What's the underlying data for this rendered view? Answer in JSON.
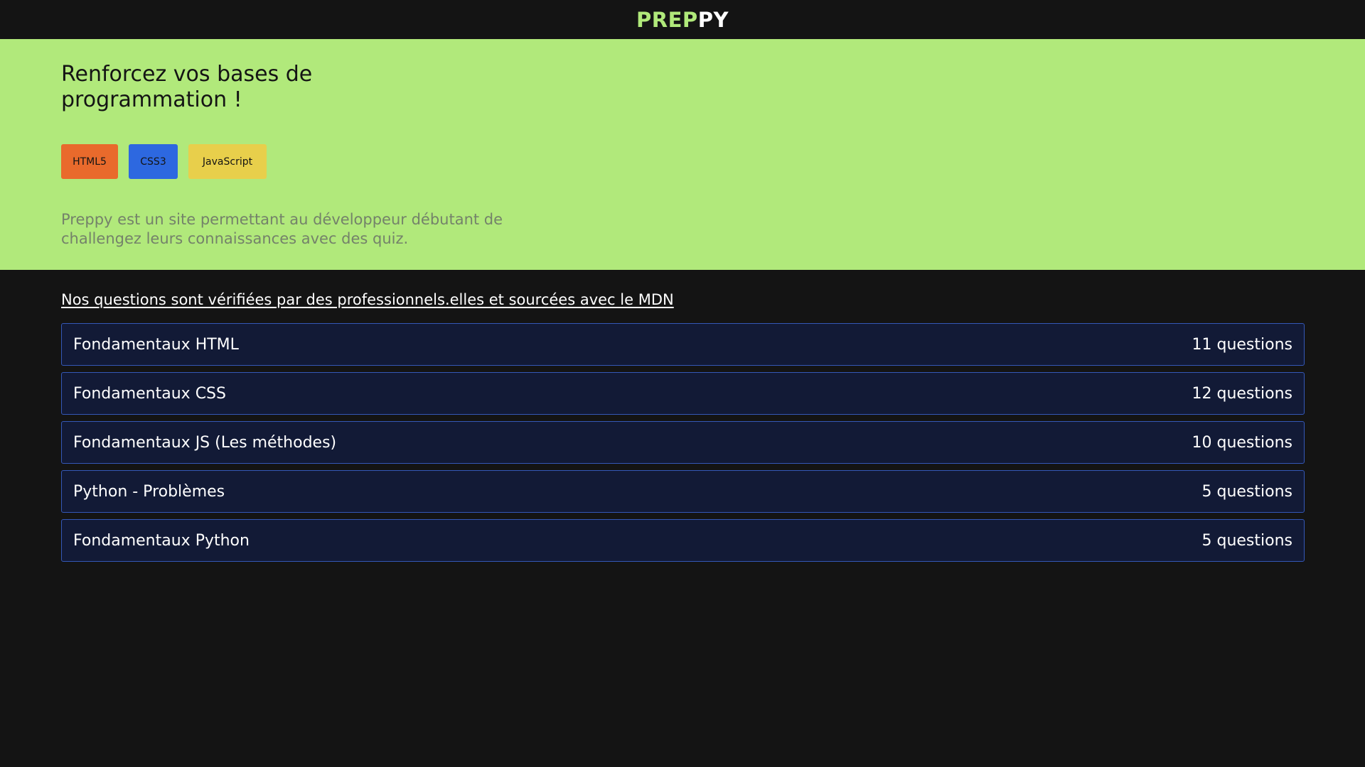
{
  "header": {
    "logo_part1": "PREP",
    "logo_part2": "PY",
    "logo_color": "#b0e97a"
  },
  "hero": {
    "title": "Renforcez vos bases de programmation !",
    "background": "#b1e97b",
    "tags": [
      {
        "label": "HTML5",
        "color": "#e96a2c"
      },
      {
        "label": "CSS3",
        "color": "#2d68e0"
      },
      {
        "label": "JavaScript",
        "color": "#e8cf4b"
      }
    ],
    "description": "Preppy est un site permettant au développeur débutant de challengez leurs connaissances avec des quiz."
  },
  "main": {
    "verified_link": "Nos questions sont vérifiées par des professionnels.elles et sourcées avec le MDN",
    "quizzes": [
      {
        "title": "Fondamentaux HTML",
        "count": "11 questions"
      },
      {
        "title": "Fondamentaux CSS",
        "count": "12 questions"
      },
      {
        "title": "Fondamentaux JS (Les méthodes)",
        "count": "10 questions"
      },
      {
        "title": "Python - Problèmes",
        "count": "5 questions"
      },
      {
        "title": "Fondamentaux Python",
        "count": "5 questions"
      }
    ]
  }
}
